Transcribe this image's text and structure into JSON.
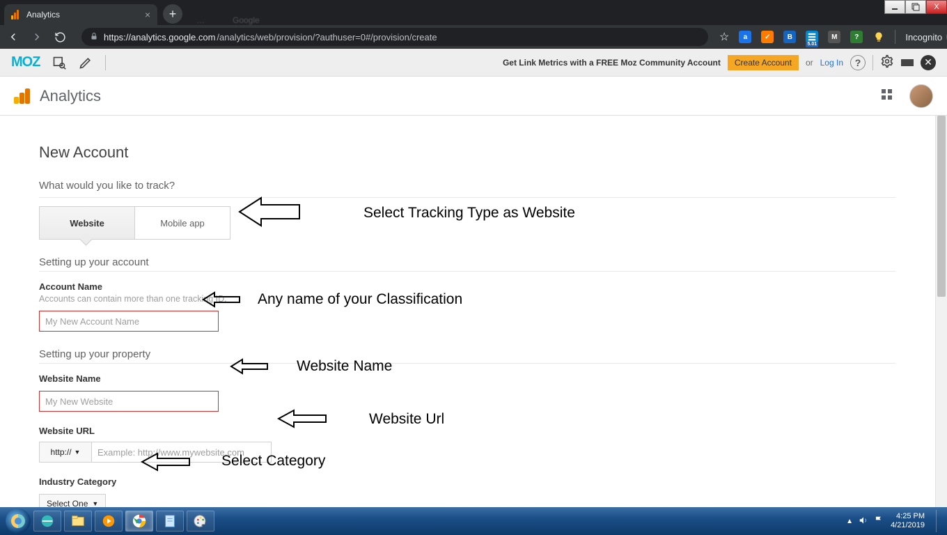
{
  "window_controls": {
    "min": "–",
    "max": "▭",
    "close": "X"
  },
  "browser": {
    "tab_title": "Analytics",
    "new_tab": "+",
    "ghost1": "…",
    "ghost2": "Google",
    "url_display_host": "https://analytics.google.com",
    "url_display_path": "/analytics/web/provision/?authuser=0#/provision/create",
    "incognito_label": "Incognito",
    "ext_badge_s": "5.01",
    "ext_a": "a",
    "ext_m": "✓",
    "ext_b": "B",
    "ext_mm": "M",
    "ext_q": "?"
  },
  "moz": {
    "logo": "MOZ",
    "message": "Get Link Metrics with a FREE Moz Community Account",
    "create": "Create Account",
    "or": "or",
    "login": "Log In",
    "help": "?"
  },
  "ga": {
    "product": "Analytics"
  },
  "form": {
    "heading": "New Account",
    "track_q": "What would you like to track?",
    "tab_website": "Website",
    "tab_mobile": "Mobile app",
    "setup_account": "Setting up your account",
    "account_name_label": "Account Name",
    "account_name_hint": "Accounts can contain more than one tracking ID.",
    "account_name_ph": "My New Account Name",
    "setup_property": "Setting up your property",
    "website_name_label": "Website Name",
    "website_name_ph": "My New Website",
    "website_url_label": "Website URL",
    "protocol": "http://",
    "website_url_ph": "Example: http://www.mywebsite.com",
    "industry_label": "Industry Category",
    "industry_select": "Select One"
  },
  "annotations": {
    "a1": "Select Tracking Type as Website",
    "a2": "Any name of your Classification",
    "a3": "Website Name",
    "a4": "Website Url",
    "a5": "Select Category"
  },
  "taskbar": {
    "time": "4:25 PM",
    "date": "4/21/2019",
    "tray_up": "▲"
  }
}
